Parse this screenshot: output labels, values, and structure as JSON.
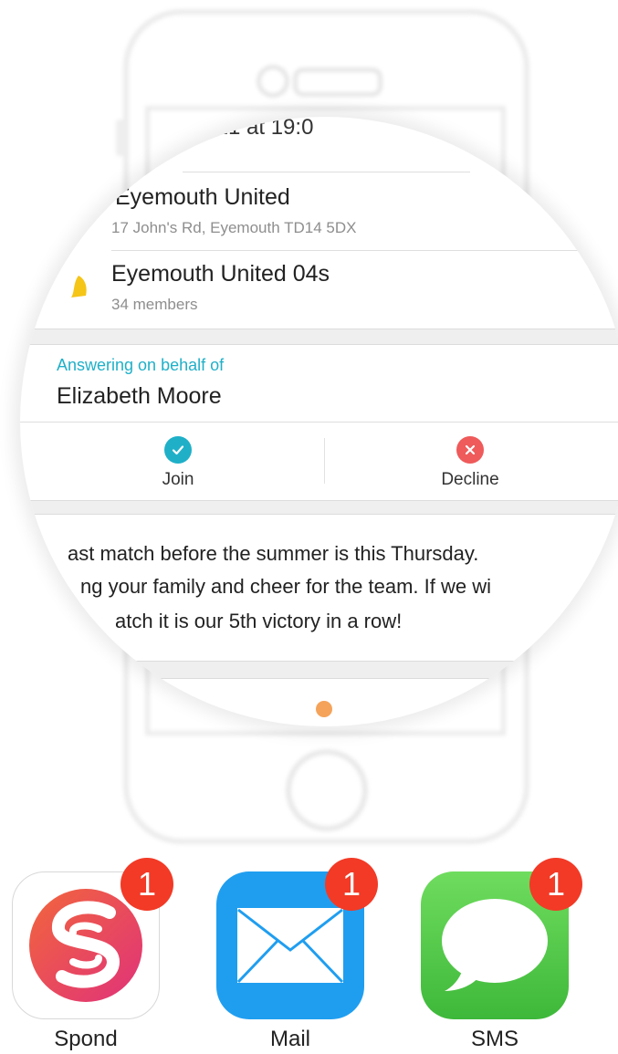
{
  "event": {
    "date_partial": "r 21 at 19:0",
    "venue_name": "Eyemouth United",
    "venue_address": "17 John's Rd, Eyemouth TD14 5DX",
    "group_name": "Eyemouth United 04s",
    "group_members": "34 members",
    "group_color": "#f5c518"
  },
  "answering": {
    "label": "Answering on behalf of",
    "name": "Elizabeth Moore",
    "label_color": "#1fb0c8"
  },
  "actions": {
    "join_label": "Join",
    "join_icon": "check-icon",
    "join_color": "#1fb0c8",
    "decline_label": "Decline",
    "decline_icon": "close-icon",
    "decline_color": "#ef5a5a"
  },
  "description": {
    "line1": "ast match before the summer is this Thursday.",
    "line2": "ng your family and cheer for the team. If we wi",
    "line3": "atch it is our 5th victory in a row!"
  },
  "apps": [
    {
      "label": "Spond",
      "badge": "1",
      "icon": "spond-icon"
    },
    {
      "label": "Mail",
      "badge": "1",
      "icon": "envelope-icon",
      "color": "#1f9ef0"
    },
    {
      "label": "SMS",
      "badge": "1",
      "icon": "speech-bubble-icon",
      "color": "#4cc24a"
    }
  ],
  "badge_color": "#f23a26"
}
